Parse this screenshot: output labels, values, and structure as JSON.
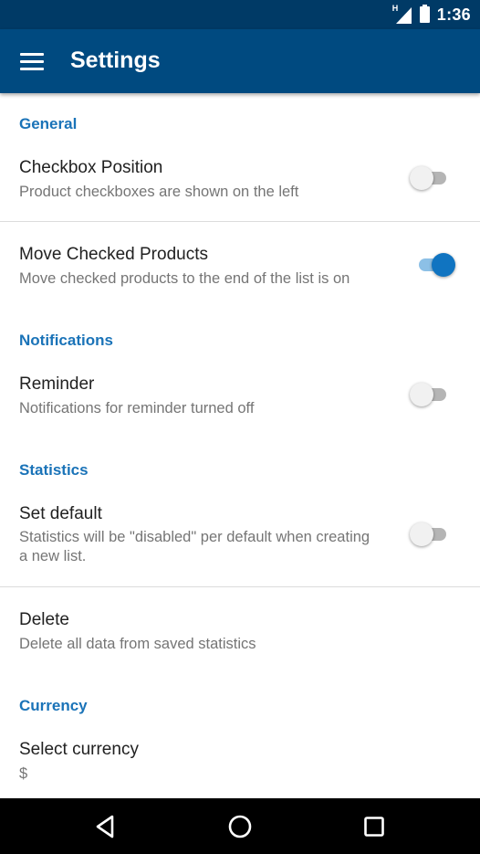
{
  "status_bar": {
    "network_label": "H",
    "time": "1:36"
  },
  "app_bar": {
    "title": "Settings"
  },
  "sections": {
    "general": {
      "header": "General",
      "checkbox_position": {
        "title": "Checkbox Position",
        "summary": "Product checkboxes are shown on the left",
        "enabled": false
      },
      "move_checked": {
        "title": "Move Checked Products",
        "summary": "Move checked products to the end of the list is on",
        "enabled": true
      }
    },
    "notifications": {
      "header": "Notifications",
      "reminder": {
        "title": "Reminder",
        "summary": "Notifications for reminder turned off",
        "enabled": false
      }
    },
    "statistics": {
      "header": "Statistics",
      "set_default": {
        "title": "Set default",
        "summary": "Statistics will be \"disabled\" per default when creating a new list.",
        "enabled": false
      },
      "delete": {
        "title": "Delete",
        "summary": "Delete all data from saved statistics"
      }
    },
    "currency": {
      "header": "Currency",
      "select_currency": {
        "title": "Select currency",
        "summary": "$"
      }
    }
  },
  "colors": {
    "app_bar": "#004a80",
    "status_bar": "#003a66",
    "accent": "#1074c1",
    "section_header": "#1a73b8"
  },
  "icons": {
    "menu": "hamburger-icon",
    "back": "back-triangle-icon",
    "home": "home-circle-icon",
    "recents": "recents-square-icon"
  }
}
